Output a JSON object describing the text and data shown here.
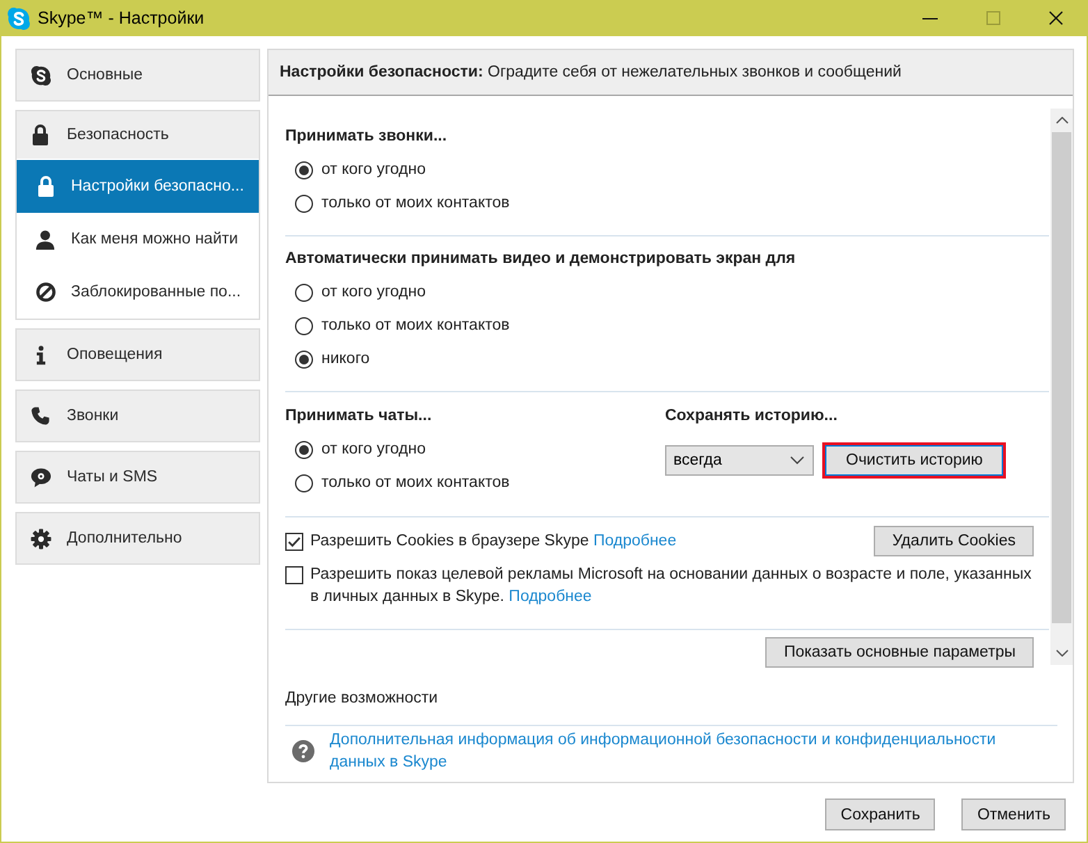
{
  "window": {
    "title": "Skype™ - Настройки",
    "maximize_disabled": true
  },
  "sidebar": {
    "items": [
      {
        "label": "Основные",
        "selected": false
      },
      {
        "label": "Безопасность",
        "selected": false,
        "children": [
          {
            "label": "Настройки безопасно...",
            "selected": true
          },
          {
            "label": "Как меня можно найти",
            "selected": false
          },
          {
            "label": "Заблокированные по...",
            "selected": false
          }
        ]
      },
      {
        "label": "Оповещения",
        "selected": false
      },
      {
        "label": "Звонки",
        "selected": false
      },
      {
        "label": "Чаты и SMS",
        "selected": false
      },
      {
        "label": "Дополнительно",
        "selected": false
      }
    ]
  },
  "panel": {
    "header": "**Настройки безопасности:** Оградите себя от нежелательных звонков и сообщений",
    "calls": {
      "heading": "Принимать звонки...",
      "options": [
        {
          "label": "от кого угодно",
          "selected": true
        },
        {
          "label": "только от моих контактов",
          "selected": false
        }
      ]
    },
    "video": {
      "heading": "Автоматически принимать видео и демонстрировать экран для",
      "options": [
        {
          "label": "от кого угодно",
          "selected": false
        },
        {
          "label": "только от моих контактов",
          "selected": false
        },
        {
          "label": "никого",
          "selected": true
        }
      ]
    },
    "chats": {
      "heading": "Принимать чаты...",
      "options": [
        {
          "label": "от кого угодно",
          "selected": true
        },
        {
          "label": "только от моих контактов",
          "selected": false
        }
      ]
    },
    "history": {
      "heading": "Сохранять историю...",
      "dropdown": {
        "value": "всегда"
      },
      "button": {
        "label": "Очистить историю",
        "focused": true,
        "highlighted": true
      }
    },
    "checkboxes": [
      {
        "text": "Разрешить Cookies в браузере Skype",
        "link": "Подробнее",
        "checked": true,
        "button": "Удалить Cookies"
      },
      {
        "text": "Разрешить показ целевой рекламы Microsoft на основании данных о возрасте и поле, указанных в личных данных в Skype.",
        "link": "Подробнее",
        "checked": false
      }
    ],
    "show_basic_button": "Показать основные параметры",
    "other": {
      "heading": "Другие возможности",
      "link": "Дополнительная информация об информационной безопасности и конфиденциальности данных в Skype"
    }
  },
  "buttons": [
    "Сохранить",
    "Отменить"
  ]
}
